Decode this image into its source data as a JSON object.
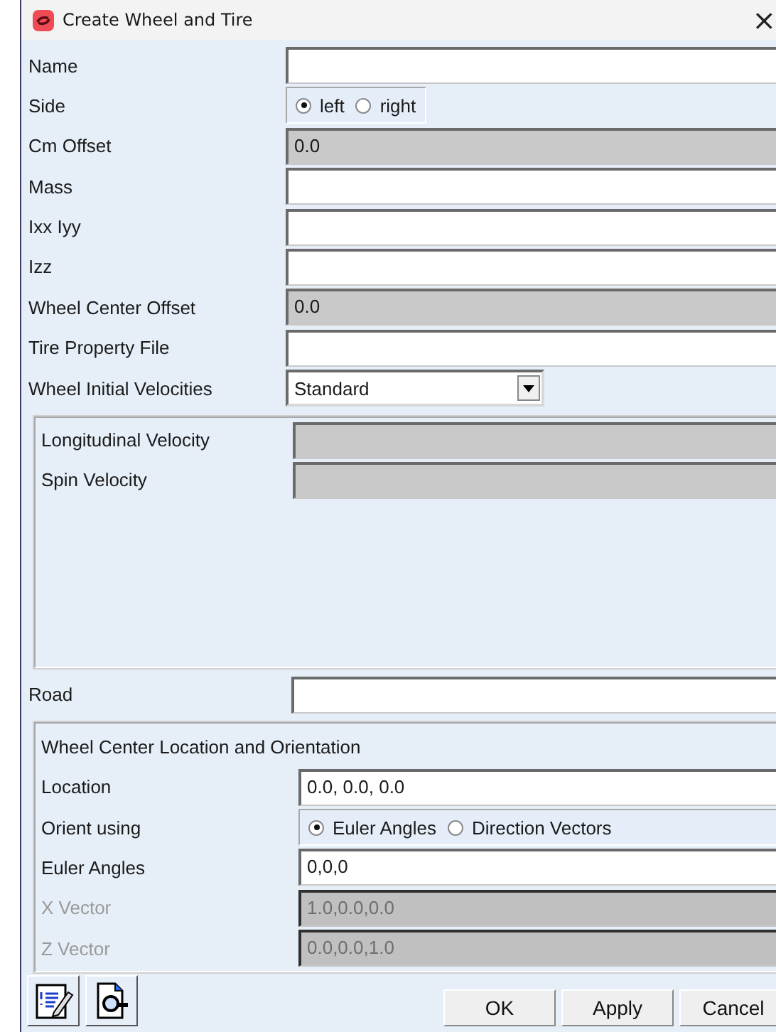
{
  "window": {
    "title": "Create Wheel and Tire",
    "close": "×"
  },
  "fields": [
    {
      "kind": "text",
      "label": "Name",
      "readonly": false,
      "disabled": false
    },
    {
      "kind": "radio",
      "label": "Side",
      "options": [
        {
          "label": "left",
          "selected": true
        },
        {
          "label": "right",
          "selected": false
        }
      ]
    },
    {
      "kind": "text",
      "label": "Cm Offset",
      "value": "0.0",
      "readonly": true,
      "disabled": false
    },
    {
      "kind": "text",
      "label": "Mass",
      "readonly": false,
      "disabled": false
    },
    {
      "kind": "text",
      "label": "Ixx Iyy",
      "readonly": false,
      "disabled": false
    },
    {
      "kind": "text",
      "label": "Izz",
      "readonly": false,
      "disabled": false
    },
    {
      "kind": "text",
      "label": "Wheel Center Offset",
      "value": "0.0",
      "readonly": true,
      "disabled": false
    },
    {
      "kind": "text",
      "label": "Tire Property File",
      "readonly": false,
      "disabled": false
    },
    {
      "kind": "dropdown",
      "label": "Wheel Initial Velocities",
      "value": "Standard"
    }
  ],
  "velocity_group": {
    "fields": [
      {
        "kind": "text",
        "label": "Longitudinal Velocity",
        "readonly": true,
        "disabled": false
      },
      {
        "kind": "text",
        "label": "Spin Velocity",
        "readonly": true,
        "disabled": false
      }
    ]
  },
  "road": {
    "kind": "text",
    "label": "Road",
    "readonly": false,
    "disabled": false
  },
  "orientation_group": {
    "title": "Wheel Center Location and Orientation",
    "fields": [
      {
        "kind": "text",
        "label": "Location",
        "value": "0.0, 0.0, 0.0",
        "readonly": false,
        "disabled": false
      },
      {
        "kind": "radio",
        "label": "Orient using",
        "options": [
          {
            "label": "Euler Angles",
            "selected": true
          },
          {
            "label": "Direction Vectors",
            "selected": false
          }
        ]
      },
      {
        "kind": "text",
        "label": "Euler Angles",
        "value": "0,0,0",
        "readonly": false,
        "disabled": false
      },
      {
        "kind": "text",
        "label": "X Vector",
        "value": "1.0,0.0,0.0",
        "readonly": false,
        "disabled": true
      },
      {
        "kind": "text",
        "label": "Z Vector",
        "value": "0.0,0.0,1.0",
        "readonly": false,
        "disabled": true
      }
    ]
  },
  "footer": {
    "buttons": [
      "OK",
      "Apply",
      "Cancel"
    ]
  }
}
